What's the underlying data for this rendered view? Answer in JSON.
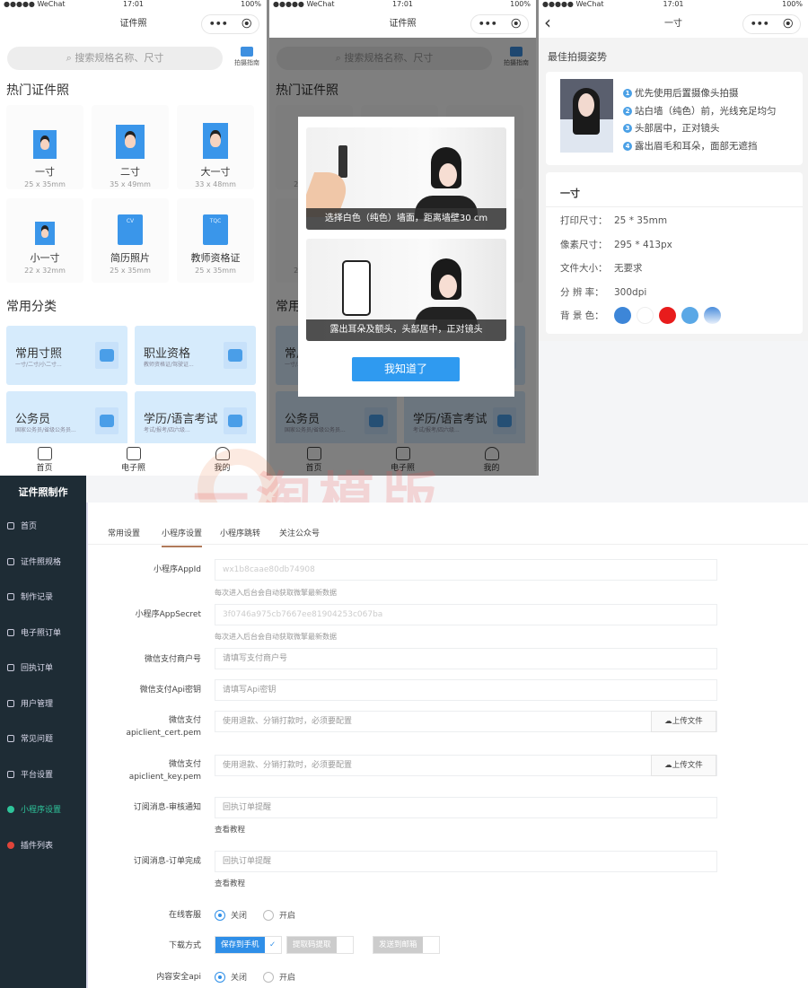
{
  "status": {
    "carrier": "●●●●● WeChat",
    "time": "17:01",
    "battery": "100%"
  },
  "capsule": {
    "more": "•••",
    "record": "⦿"
  },
  "home": {
    "title": "证件照",
    "search_placeholder": "搜索规格名称、尺寸",
    "guide": "拍摄指南",
    "hot_title": "热门证件照",
    "hot": [
      {
        "name": "一寸",
        "size": "25 x 35mm"
      },
      {
        "name": "二寸",
        "size": "35 x 49mm"
      },
      {
        "name": "大一寸",
        "size": "33 x 48mm"
      },
      {
        "name": "小一寸",
        "size": "22 x 32mm"
      },
      {
        "name": "简历照片",
        "size": "25 x 35mm",
        "badge": "CV"
      },
      {
        "name": "教师资格证",
        "size": "25 x 35mm",
        "badge": "TQC"
      }
    ],
    "cat_title": "常用分类",
    "cats": [
      {
        "title": "常用寸照",
        "sub": "一寸/二寸/小二寸..."
      },
      {
        "title": "职业资格",
        "sub": "教师资格证/驾驶证..."
      },
      {
        "title": "公务员",
        "sub": "国家公务员/省级公务员..."
      },
      {
        "title": "学历/语言考试",
        "sub": "考试/报考/四六级..."
      }
    ],
    "tabs": [
      {
        "label": "首页",
        "icon": "home-icon"
      },
      {
        "label": "电子照",
        "icon": "document-icon"
      },
      {
        "label": "我的",
        "icon": "user-icon"
      }
    ]
  },
  "modal": {
    "cap1": "选择白色（纯色）墙面，距离墙壁30 cm",
    "cap2": "露出耳朵及额头，头部居中，正对镜头",
    "ok": "我知道了"
  },
  "detail": {
    "title": "一寸",
    "back": "‹",
    "pose_title": "最佳拍摄姿势",
    "tips": [
      "优先使用后置摄像头拍摄",
      "站白墙（纯色）前，光线充足均匀",
      "头部居中，正对镜头",
      "露出眉毛和耳朵，面部无遮挡"
    ],
    "spec_title": "一寸",
    "specs": [
      {
        "k": "打印尺寸：",
        "v": "25 * 35mm"
      },
      {
        "k": "像素尺寸：",
        "v": "295 * 413px"
      },
      {
        "k": "文件大小：",
        "v": "无要求"
      },
      {
        "k": "分 辨 率：",
        "v": "300dpi"
      }
    ],
    "bg_label": "背 景 色：",
    "bg_colors": [
      "#3d86d8",
      "#ffffff",
      "#e81c1c",
      "#5aa8e6",
      "linear-gradient(#4a8ddc,#e8f0fb)"
    ]
  },
  "watermark": "一淘模版",
  "admin": {
    "brand": "证件照制作",
    "menu": [
      {
        "label": "首页",
        "icon": "home-icon"
      },
      {
        "label": "证件照规格",
        "icon": "spec-icon"
      },
      {
        "label": "制作记录",
        "icon": "clock-icon"
      },
      {
        "label": "电子照订单",
        "icon": "order-icon"
      },
      {
        "label": "回执订单",
        "icon": "print-icon"
      },
      {
        "label": "用户管理",
        "icon": "user-icon"
      },
      {
        "label": "常见问题",
        "icon": "faq-icon"
      },
      {
        "label": "平台设置",
        "icon": "gear-icon"
      },
      {
        "label": "小程序设置",
        "icon": "miniprogram-icon",
        "active": true
      },
      {
        "label": "插件列表",
        "icon": "plugin-icon"
      }
    ],
    "tabs": [
      "常用设置",
      "小程序设置",
      "小程序跳转",
      "关注公众号"
    ],
    "active_tab": "小程序设置",
    "form": {
      "appid": {
        "label": "小程序AppId",
        "value": "wx1b8caae80db74908",
        "hint": "每次进入后台会自动获取微擎最新数据"
      },
      "secret": {
        "label": "小程序AppSecret",
        "value": "3f0746a975cb7667ee81904253c067ba",
        "hint": "每次进入后台会自动获取微擎最新数据"
      },
      "mch": {
        "label": "微信支付商户号",
        "placeholder": "请填写支付商户号"
      },
      "apikey": {
        "label": "微信支付Api密钥",
        "placeholder": "请填写Api密钥"
      },
      "cert": {
        "label1": "微信支付",
        "label2": "apiclient_cert.pem",
        "placeholder": "使用退款、分销打款时，必须要配置",
        "upload": "上传文件"
      },
      "key": {
        "label1": "微信支付",
        "label2": "apiclient_key.pem",
        "placeholder": "使用退款、分销打款时，必须要配置",
        "upload": "上传文件"
      },
      "sub_audit": {
        "label": "订阅消息-审核通知",
        "placeholder": "回执订单提醒",
        "link": "查看教程"
      },
      "sub_done": {
        "label": "订阅消息-订单完成",
        "placeholder": "回执订单提醒",
        "link": "查看教程"
      },
      "service": {
        "label": "在线客服",
        "off": "关闭",
        "on": "开启",
        "selected": "关闭"
      },
      "download": {
        "label": "下载方式",
        "options": [
          {
            "label": "保存到手机",
            "checked": true
          },
          {
            "label": "提取码提取",
            "checked": false
          },
          {
            "label": "发送到邮箱",
            "checked": false
          }
        ]
      },
      "security": {
        "label": "内容安全api",
        "off": "关闭",
        "on": "开启",
        "selected": "关闭"
      }
    }
  }
}
